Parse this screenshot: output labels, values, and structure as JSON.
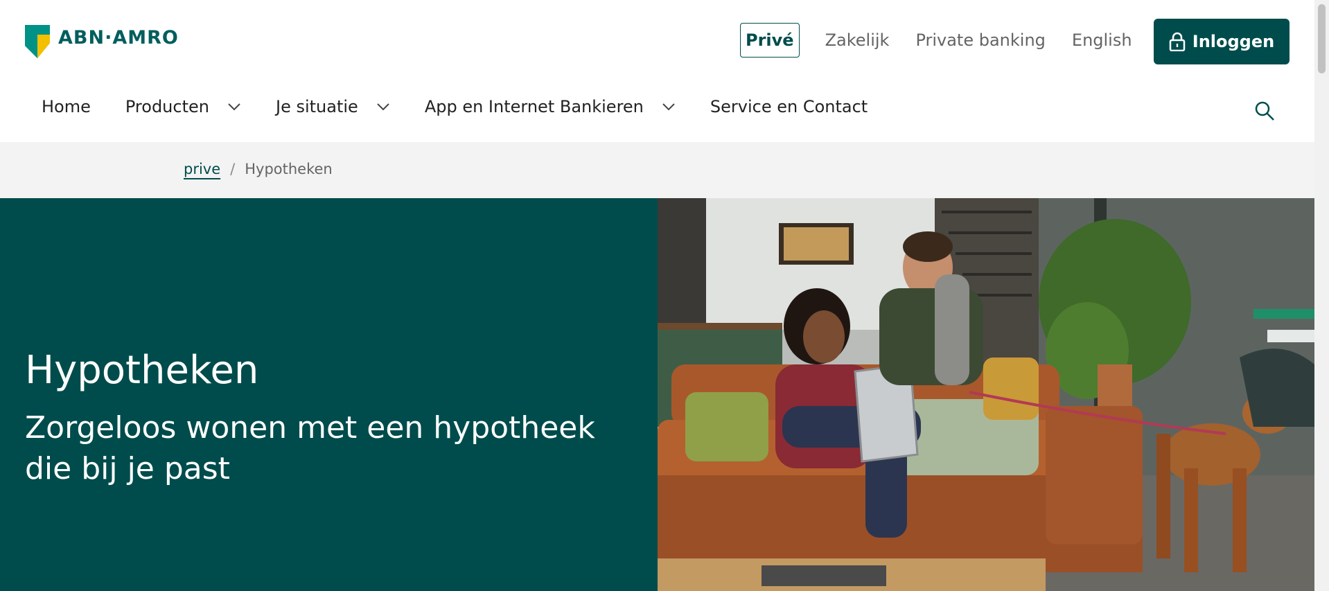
{
  "brand": {
    "name": "ABN·AMRO",
    "primary_color": "#004c4c",
    "shield_green": "#009286",
    "shield_yellow": "#f3c000"
  },
  "topnav": {
    "items": [
      {
        "label": "Privé",
        "active": true
      },
      {
        "label": "Zakelijk"
      },
      {
        "label": "Private banking"
      },
      {
        "label": "English"
      }
    ],
    "login_label": "Inloggen"
  },
  "mainnav": {
    "items": [
      {
        "label": "Home",
        "dropdown": false
      },
      {
        "label": "Producten",
        "dropdown": true
      },
      {
        "label": "Je situatie",
        "dropdown": true
      },
      {
        "label": "App en Internet Bankieren",
        "dropdown": true
      },
      {
        "label": "Service en Contact",
        "dropdown": false
      }
    ]
  },
  "breadcrumb": {
    "items": [
      "prive",
      "Hypotheken"
    ],
    "separator": "/"
  },
  "hero": {
    "title": "Hypotheken",
    "subtitle": "Zorgeloos wonen met een hypotheek die bij je past"
  }
}
